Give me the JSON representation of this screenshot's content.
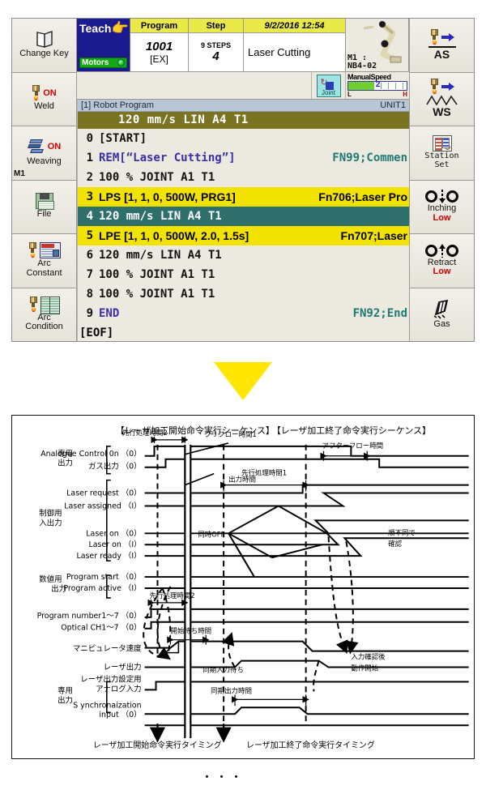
{
  "pendant": {
    "left_buttons": [
      {
        "name": "change-key",
        "label": "Change Key",
        "icon": "book-open-icon",
        "status": "",
        "sub": ""
      },
      {
        "name": "weld",
        "label": "Weld",
        "icon": "torch-icon",
        "status": "ON",
        "sub": ""
      },
      {
        "name": "weaving",
        "label": "Weaving",
        "icon": "weaving-icon",
        "status": "ON",
        "sub": "M1"
      },
      {
        "name": "file",
        "label": "File",
        "icon": "floppy-icon",
        "status": "",
        "sub": ""
      },
      {
        "name": "arc-constant",
        "label": "Arc\nConstant",
        "icon": "monitor-icon",
        "status": "",
        "sub": ""
      },
      {
        "name": "arc-condition",
        "label": "Arc\nCondition",
        "icon": "book-icon",
        "status": "",
        "sub": ""
      }
    ],
    "right_buttons": [
      {
        "name": "as",
        "label": "AS",
        "icon": "torch-arrow-icon",
        "low": ""
      },
      {
        "name": "ws",
        "label": "WS",
        "icon": "torch-weave-icon",
        "low": ""
      },
      {
        "name": "station-set",
        "label": "Station\nSet",
        "icon": "station-set-icon",
        "low": ""
      },
      {
        "name": "inching",
        "label": "Inching",
        "icon": "inching-icon",
        "low": "Low"
      },
      {
        "name": "retract",
        "label": "Retract",
        "icon": "retract-icon",
        "low": "Low"
      },
      {
        "name": "gas",
        "label": "Gas",
        "icon": "gas-icon",
        "low": ""
      }
    ],
    "mode": {
      "teach": "Teach",
      "motors": "Motors"
    },
    "fields": {
      "program_header": "Program",
      "program_number": "1001",
      "program_mode": "[EX]",
      "step_header": "Step",
      "step_total": "9 STEPS",
      "step_current": "4",
      "datetime_header": "9/2/2016   12:54",
      "comment": "Laser Cutting"
    },
    "robot": {
      "id": "M1 :",
      "model": "NB4-02"
    },
    "coord_system": "Joint",
    "manual_speed": {
      "label": "ManualSpeed",
      "value": "2",
      "low": "L",
      "high": "H"
    },
    "program_panel": {
      "title": "[1] Robot Program",
      "unit": "UNIT1",
      "header_row": "120  mm/s  LIN    A4  T1",
      "rows": [
        {
          "ln": "0",
          "text": "[START]",
          "fn": "",
          "style": "plain"
        },
        {
          "ln": "1",
          "text": "REM[“Laser Cutting”]",
          "fn": "FN99;Commen",
          "style": "purple"
        },
        {
          "ln": "2",
          "text": "100  %      JOINT A1  T1",
          "fn": "",
          "style": "plain"
        },
        {
          "ln": "3",
          "text": "LPS [1, 1, 0, 500W, PRG1]",
          "fn": "Fn706;Laser Pro",
          "style": "hl-yellow"
        },
        {
          "ln": "4",
          "text": "120  mm/s  LIN    A4  T1",
          "fn": "",
          "style": "hl-teal"
        },
        {
          "ln": "5",
          "text": "LPE [1, 1, 0, 500W, 2.0, 1.5s]",
          "fn": "Fn707;Laser",
          "style": "hl-yellow"
        },
        {
          "ln": "6",
          "text": "120  mm/s  LIN    A4  T1",
          "fn": "",
          "style": "plain"
        },
        {
          "ln": "7",
          "text": "100  %      JOINT A1  T1",
          "fn": "",
          "style": "plain"
        },
        {
          "ln": "8",
          "text": "100  %      JOINT A1  T1",
          "fn": "",
          "style": "plain"
        },
        {
          "ln": "9",
          "text": "END",
          "fn": "FN92;End",
          "style": "purple"
        }
      ],
      "eof": "[EOF]"
    }
  },
  "timing": {
    "title_left": "【レーザ加工開始命令実行シーケンス】",
    "title_right": "【レーザ加工終了命令実行シーケンス】",
    "groups": [
      {
        "name": "dedicated-output-top",
        "label": "専用\n出力"
      },
      {
        "name": "control-io",
        "label": "制御用\n入出力"
      },
      {
        "name": "numeric-output",
        "label": "数値用\n出力"
      },
      {
        "name": "dedicated-output-bottom",
        "label": "専用\n出力"
      }
    ],
    "signals": [
      "Analogue Control 0n （0）",
      "ガス出力 （0）",
      "Laser request （0）",
      "Laser assigned （I）",
      "Laser on （0）",
      "Laser on （I）",
      "Laser ready （I）",
      "Program start （0）",
      "Program active （I）",
      "Program number1～7 （0）",
      "Optical CH1～7 （0）",
      "マニピュレータ速度",
      "レーザ出力",
      "レーザ出力設定用\nアナログ入力",
      "S ynchronaization\ninput （0）"
    ],
    "annotations": [
      "先行処理時間2",
      "プリフロー時間1",
      "先行処理時間1",
      "先行処理時間2",
      "開始待ち時間",
      "アフターフロー時間",
      "出力時間",
      "同時OFF",
      "順不同で\n確認",
      "同期入力待ち",
      "入力確認後\n動作開始",
      "同期出力時間"
    ],
    "caption_left": "レーザ加工開始命令実行タイミング",
    "caption_right": "レーザ加工終了命令実行タイミング"
  },
  "footer": {
    "ellipsis": "・・・"
  },
  "colors": {
    "mode_blue": "#1b1b8f",
    "header_yellow": "#e9e94a",
    "highlight_yellow": "#f2e200",
    "selected_teal": "#2e6e6b",
    "list_header_olive": "#7a7322",
    "arrow_yellow": "#ffe600",
    "motors_green": "#14a814",
    "fn_teal": "#1f7a72"
  }
}
